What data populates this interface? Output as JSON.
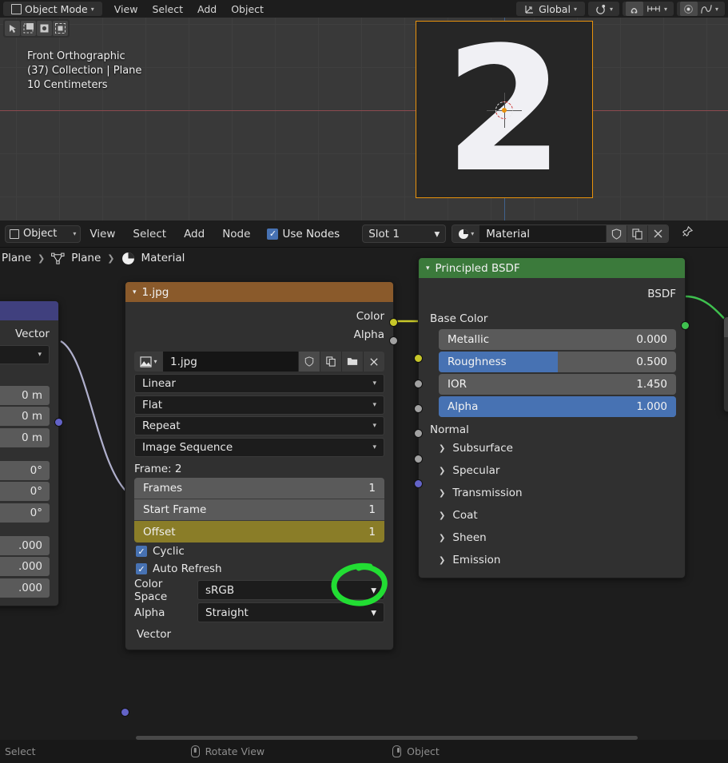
{
  "app": "blender",
  "viewport": {
    "header": {
      "mode_label": "Object Mode",
      "menus": [
        "View",
        "Select",
        "Add",
        "Object"
      ],
      "orientation_label": "Global",
      "pivot_icon": "pivot-point-icon",
      "snap_icon": "snap-magnet-icon",
      "snap_to_icon": "snap-increment-icon",
      "proportional_icon": "proportional-editing-icon",
      "falloff_icon": "falloff-curve-icon"
    },
    "tools": [
      "tweak-tool",
      "select-box-tool",
      "select-circle-tool",
      "select-lasso-tool"
    ],
    "overlay_text": {
      "view_name": "Front Orthographic",
      "collection_object": "(37) Collection | Plane",
      "grid_scale": "10 Centimeters"
    },
    "object_texture_digit": "2",
    "object_outline_color": "#e8920c"
  },
  "node_editor": {
    "header": {
      "shader_type": "Object",
      "menus": [
        "View",
        "Select",
        "Add",
        "Node"
      ],
      "use_nodes_label": "Use Nodes",
      "use_nodes_checked": true,
      "slot_label": "Slot 1",
      "material_name": "Material",
      "buttons": [
        "shield-icon",
        "duplicate-icon",
        "close-x-icon",
        "pin-icon"
      ]
    },
    "breadcrumb": [
      "Plane",
      "Plane",
      "Material"
    ],
    "nodes": {
      "mapping": {
        "title_hidden": true,
        "header_color": "#40407e",
        "output_label": "Vector",
        "vector_type_value": "",
        "location": [
          "0 m",
          "0 m",
          "0 m"
        ],
        "rotation": [
          "0°",
          "0°",
          "0°"
        ],
        "scale": [
          ".000",
          ".000",
          ".000"
        ]
      },
      "image_texture": {
        "title": "1.jpg",
        "header_color": "#8a5a2b",
        "outputs": [
          {
            "label": "Color",
            "socket": "yellow"
          },
          {
            "label": "Alpha",
            "socket": "grey"
          }
        ],
        "image_name": "1.jpg",
        "image_buttons": [
          "shield-icon",
          "duplicate-icon",
          "folder-open-icon",
          "close-x-icon"
        ],
        "interpolation": "Linear",
        "projection": "Flat",
        "extension": "Repeat",
        "source": "Image Sequence",
        "frame_info": "Frame: 2",
        "sequence_fields": [
          {
            "label": "Frames",
            "value": "1",
            "highlight": false
          },
          {
            "label": "Start Frame",
            "value": "1",
            "highlight": false
          },
          {
            "label": "Offset",
            "value": "1",
            "highlight": true
          }
        ],
        "cyclic_label": "Cyclic",
        "cyclic_checked": true,
        "auto_refresh_label": "Auto Refresh",
        "auto_refresh_checked": true,
        "color_space_label": "Color Space",
        "color_space_value": "sRGB",
        "alpha_label": "Alpha",
        "alpha_value": "Straight",
        "input_label": "Vector"
      },
      "principled_bsdf": {
        "title": "Principled BSDF",
        "header_color": "#3b7a3b",
        "output_label": "BSDF",
        "base_color_label": "Base Color",
        "sliders": [
          {
            "label": "Metallic",
            "value": "0.000",
            "fill_pct": 0
          },
          {
            "label": "Roughness",
            "value": "0.500",
            "fill_pct": 50
          },
          {
            "label": "IOR",
            "value": "1.450",
            "fill_pct": 0
          },
          {
            "label": "Alpha",
            "value": "1.000",
            "fill_pct": 100
          }
        ],
        "normal_label": "Normal",
        "panels": [
          "Subsurface",
          "Specular",
          "Transmission",
          "Coat",
          "Sheen",
          "Emission"
        ]
      }
    },
    "annotation": {
      "shape": "green-circle-scribble",
      "color": "#22dd33",
      "target": "Offset value"
    }
  },
  "status_bar": {
    "items": [
      {
        "icon": "mouse-left-icon",
        "label": "Select"
      },
      {
        "icon": "mouse-middle-icon",
        "label": "Rotate View"
      },
      {
        "icon": "mouse-right-icon",
        "label": "Object"
      }
    ]
  }
}
